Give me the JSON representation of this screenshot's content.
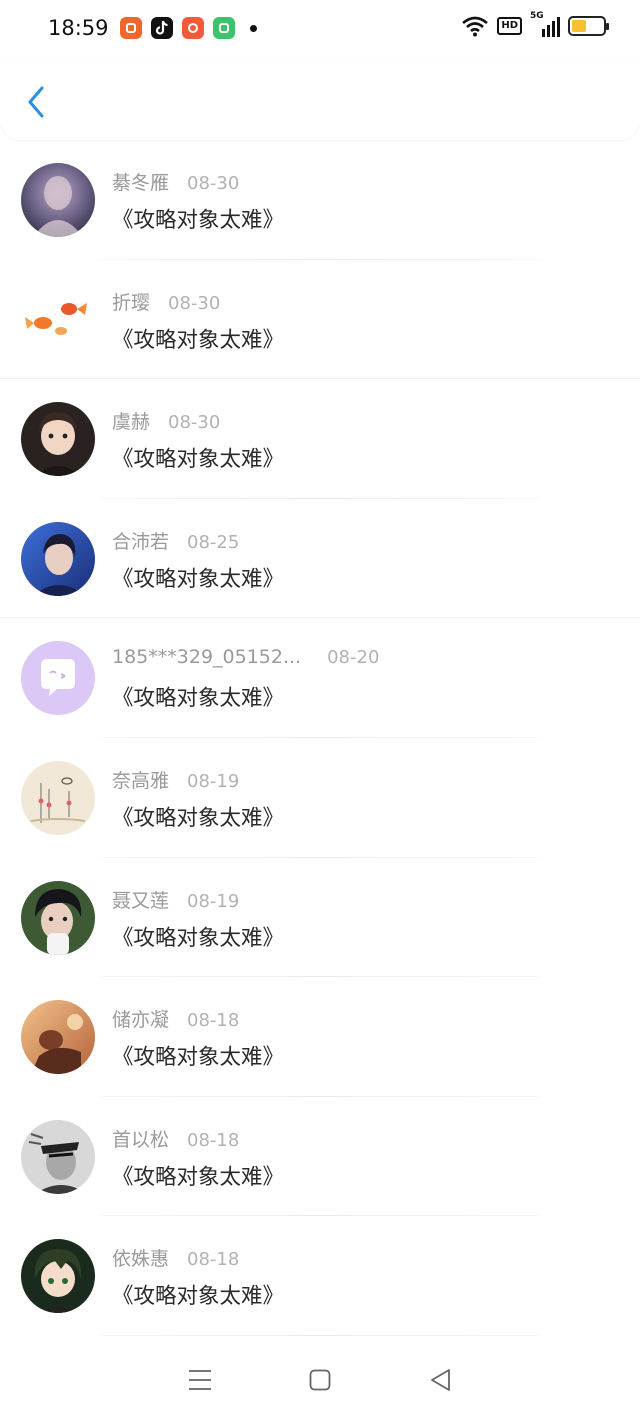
{
  "status_bar": {
    "time": "18:59",
    "app_icons": [
      "kuaishou-icon",
      "tiktok-icon",
      "taobao-icon",
      "app-store-icon"
    ],
    "network": "5G",
    "hd": "HD",
    "battery_level": 0.45,
    "battery_color": "#f5c12e"
  },
  "header": {
    "back_icon": "chevron-left-icon",
    "accent": "#2b8fe0"
  },
  "items": [
    {
      "name": "綦冬雁",
      "date": "08-30",
      "title": "《攻略对象太难》",
      "avatar": "avatar-1"
    },
    {
      "name": "折璎",
      "date": "08-30",
      "title": "《攻略对象太难》",
      "avatar": "avatar-2"
    },
    {
      "name": "虞赫",
      "date": "08-30",
      "title": "《攻略对象太难》",
      "avatar": "avatar-3"
    },
    {
      "name": "合沛若",
      "date": "08-25",
      "title": "《攻略对象太难》",
      "avatar": "avatar-4"
    },
    {
      "name": "185***329_05152...",
      "date": "08-20",
      "title": "《攻略对象太难》",
      "avatar": "default-chat-avatar"
    },
    {
      "name": "奈高雅",
      "date": "08-19",
      "title": "《攻略对象太难》",
      "avatar": "avatar-6"
    },
    {
      "name": "聂又莲",
      "date": "08-19",
      "title": "《攻略对象太难》",
      "avatar": "avatar-7"
    },
    {
      "name": "储亦凝",
      "date": "08-18",
      "title": "《攻略对象太难》",
      "avatar": "avatar-8"
    },
    {
      "name": "首以松",
      "date": "08-18",
      "title": "《攻略对象太难》",
      "avatar": "avatar-9"
    },
    {
      "name": "依姝惠",
      "date": "08-18",
      "title": "《攻略对象太难》",
      "avatar": "avatar-10"
    }
  ],
  "nav_bar": {
    "buttons": [
      "menu-icon",
      "home-icon",
      "back-triangle-icon"
    ]
  }
}
